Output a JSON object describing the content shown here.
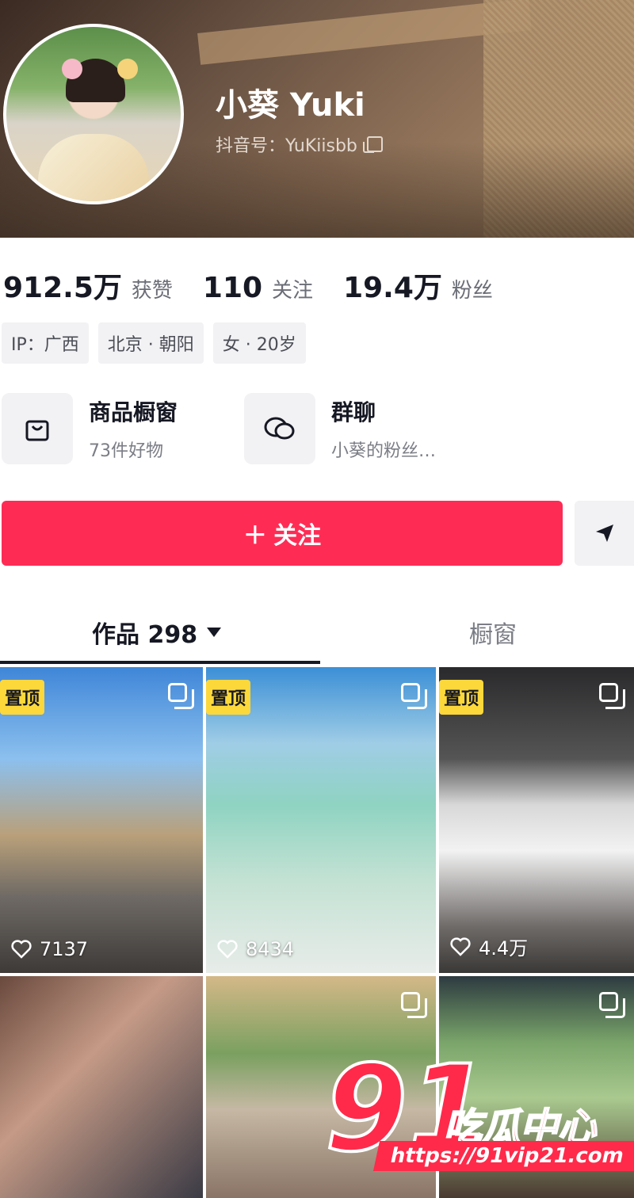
{
  "profile": {
    "name": "小葵 Yuki",
    "douyin_id": "抖音号：YuKiisbb"
  },
  "stats": [
    {
      "value": "912.5万",
      "label": "获赞"
    },
    {
      "value": "110",
      "label": "关注"
    },
    {
      "value": "19.4万",
      "label": "粉丝"
    }
  ],
  "tags": [
    "IP：广西",
    "北京 · 朝阳",
    "女 · 20岁"
  ],
  "entries": {
    "shop": {
      "title": "商品橱窗",
      "subtitle": "73件好物",
      "icon": "shopping-bag-icon"
    },
    "group": {
      "title": "群聊",
      "subtitle": "小葵的粉丝…",
      "icon": "chat-bubbles-icon"
    }
  },
  "actions": {
    "follow_label": "＋ 关注",
    "share_icon": "send-icon"
  },
  "tabs": {
    "works_label": "作品 298",
    "showcase_label": "橱窗"
  },
  "videos": [
    {
      "pinned": true,
      "pin_label": "置顶",
      "likes": "7137",
      "multi": true
    },
    {
      "pinned": true,
      "pin_label": "置顶",
      "likes": "8434",
      "multi": true
    },
    {
      "pinned": true,
      "pin_label": "置顶",
      "likes": "4.4万",
      "multi": true
    },
    {
      "pinned": false,
      "multi": false
    },
    {
      "pinned": false,
      "multi": true
    },
    {
      "pinned": false,
      "multi": true
    }
  ],
  "watermark": {
    "brand_number": "91",
    "brand_text": "吃瓜中心",
    "url": "https://91vip21.com"
  },
  "colors": {
    "accent": "#fe2c55",
    "pin": "#fcd83b"
  }
}
